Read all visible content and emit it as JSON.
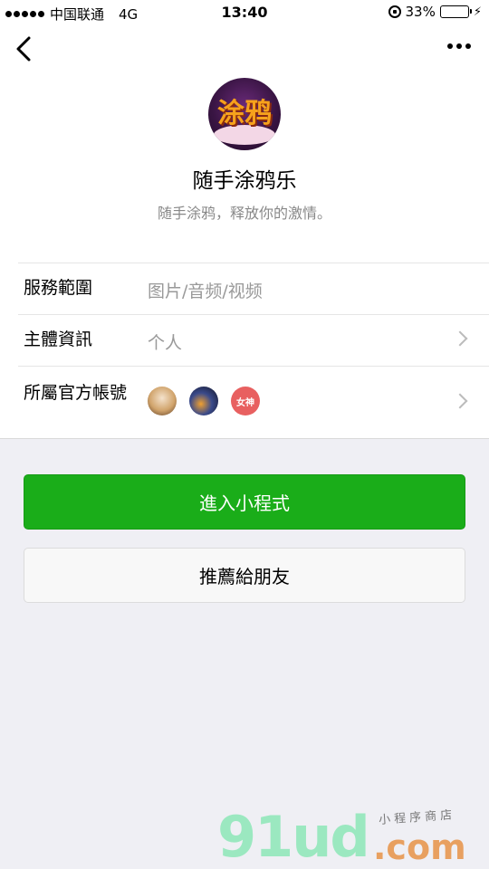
{
  "status_bar": {
    "carrier": "中国联通",
    "network": "4G",
    "time": "13:40",
    "battery": "33%",
    "battery_level": 0.33
  },
  "nav": {
    "back_icon": "chevron-left-icon",
    "more_icon": "more-dots-icon"
  },
  "profile": {
    "name": "随手涂鸦乐",
    "description": "随手涂鸦，释放你的激情。",
    "logo_text": "涂鸦"
  },
  "info": {
    "rows": [
      {
        "label": "服務範圍",
        "value": "图片/音频/视频"
      },
      {
        "label": "主體資訊",
        "value": "个人"
      },
      {
        "label": "所屬官方帳號",
        "value": ""
      }
    ],
    "official_account_avatar_3_text": "女神"
  },
  "buttons": {
    "enter": "進入小程式",
    "recommend": "推薦給朋友"
  },
  "colors": {
    "primary": "#1aad19",
    "background": "#efeff4"
  },
  "watermark": {
    "brand": "91ud",
    "domain": ".com",
    "tagline": "小程序商店"
  }
}
